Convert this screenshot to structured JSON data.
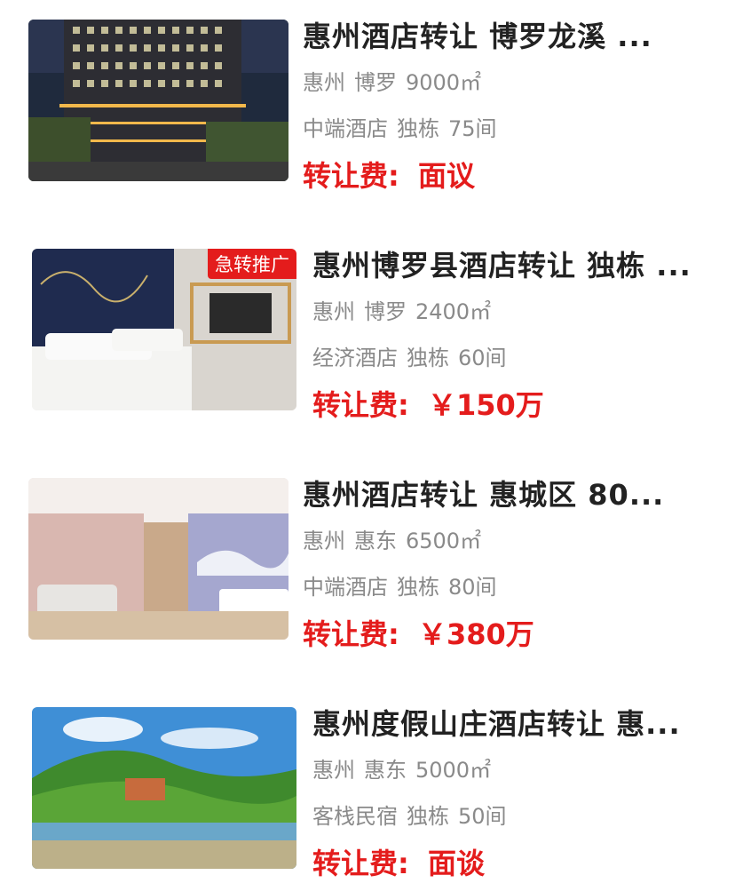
{
  "listings": [
    {
      "title": "惠州酒店转让 博罗龙溪 ...",
      "city": "惠州",
      "district": "博罗",
      "area": "9000㎡",
      "grade": "中端酒店",
      "building": "独栋",
      "rooms": "75间",
      "price_label": "转让费:",
      "price": "面议",
      "badge": ""
    },
    {
      "title": "惠州博罗县酒店转让 独栋 ...",
      "city": "惠州",
      "district": "博罗",
      "area": "2400㎡",
      "grade": "经济酒店",
      "building": "独栋",
      "rooms": "60间",
      "price_label": "转让费:",
      "price": "￥150万",
      "badge": "急转推广"
    },
    {
      "title": "惠州酒店转让 惠城区 80...",
      "city": "惠州",
      "district": "惠东",
      "area": "6500㎡",
      "grade": "中端酒店",
      "building": "独栋",
      "rooms": "80间",
      "price_label": "转让费:",
      "price": "￥380万",
      "badge": ""
    },
    {
      "title": "惠州度假山庄酒店转让 惠...",
      "city": "惠州",
      "district": "惠东",
      "area": "5000㎡",
      "grade": "客栈民宿",
      "building": "独栋",
      "rooms": "50间",
      "price_label": "转让费:",
      "price": "面谈",
      "badge": ""
    }
  ],
  "colors": {
    "price": "#e41c1c",
    "title": "#222222",
    "meta": "#8a8a8a"
  }
}
